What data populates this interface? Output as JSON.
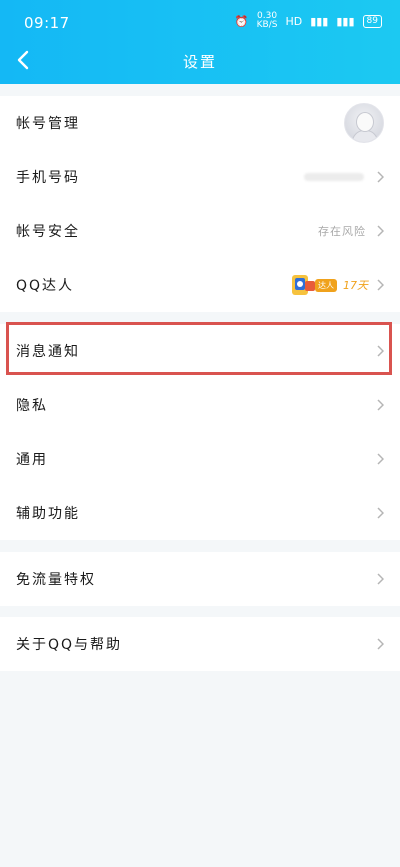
{
  "status_bar": {
    "time": "09:17",
    "speed_value": "0.30",
    "speed_unit": "KB/S",
    "hd_label": "HD",
    "battery": "89"
  },
  "nav": {
    "title": "设置"
  },
  "groups": [
    {
      "items": [
        {
          "label": "帐号管理"
        },
        {
          "label": "手机号码"
        },
        {
          "label": "帐号安全",
          "value": "存在风险"
        },
        {
          "label": "QQ达人",
          "badge_tag": "达人",
          "badge_days": "17天"
        }
      ]
    },
    {
      "items": [
        {
          "label": "消息通知"
        },
        {
          "label": "隐私"
        },
        {
          "label": "通用"
        },
        {
          "label": "辅助功能"
        }
      ]
    },
    {
      "items": [
        {
          "label": "免流量特权"
        }
      ]
    },
    {
      "items": [
        {
          "label": "关于QQ与帮助"
        }
      ]
    }
  ],
  "colors": {
    "header": "#14b8f5",
    "highlight": "#d9534f",
    "badge": "#f0a21c"
  }
}
